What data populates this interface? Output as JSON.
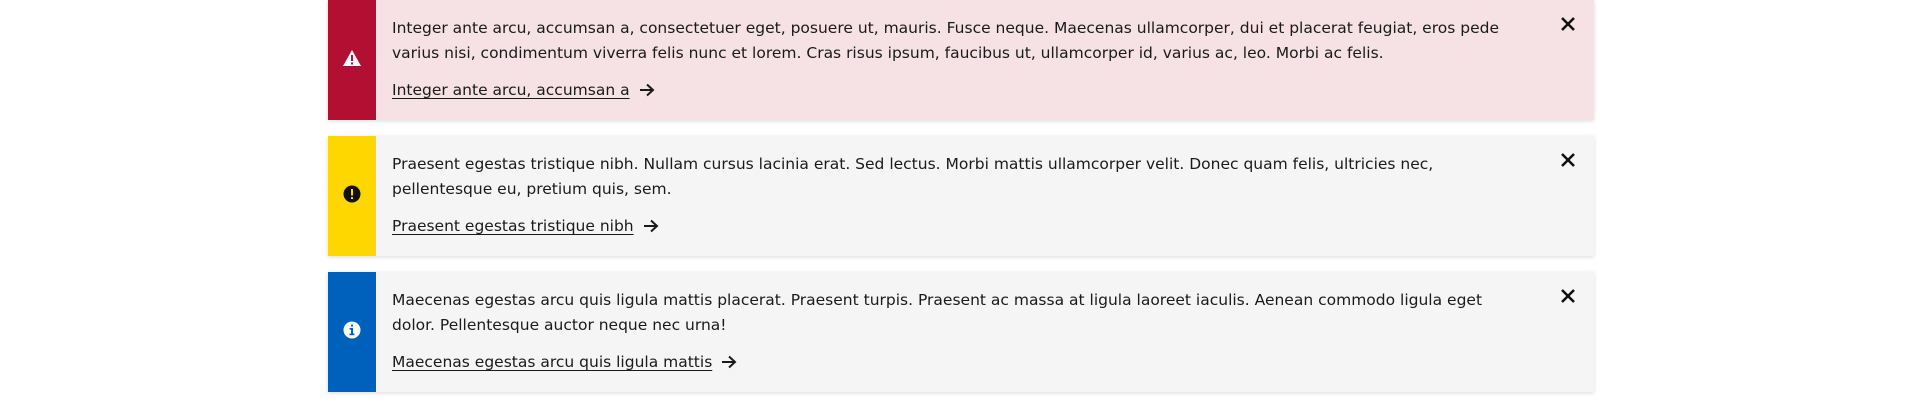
{
  "alerts": [
    {
      "type": "error",
      "icon": "warning-triangle-icon",
      "accent_color": "#b20f33",
      "background": "#f6e1e5",
      "text": "Integer ante arcu, accumsan a, consectetuer eget, posuere ut, mauris. Fusce neque. Maecenas ullamcorper, dui et placerat feugiat, eros pede varius nisi, condimentum viverra felis nunc et lorem. Cras risus ipsum, faucibus ut, ullamcorper id, varius ac, leo. Morbi ac felis.",
      "link_label": "Integer ante arcu, accumsan a",
      "close_icon": "close-icon"
    },
    {
      "type": "warning",
      "icon": "exclamation-circle-icon",
      "accent_color": "#ffd700",
      "background": "#f5f5f5",
      "text": "Praesent egestas tristique nibh. Nullam cursus lacinia erat. Sed lectus. Morbi mattis ullamcorper velit. Donec quam felis, ultricies nec, pellentesque eu, pretium quis, sem.",
      "link_label": "Praesent egestas tristique nibh",
      "close_icon": "close-icon"
    },
    {
      "type": "info",
      "icon": "info-circle-icon",
      "accent_color": "#0061bc",
      "background": "#f5f5f5",
      "text": "Maecenas egestas arcu quis ligula mattis placerat. Praesent turpis. Praesent ac massa at ligula laoreet iaculis. Aenean commodo ligula eget dolor. Pellentesque auctor neque nec urna!",
      "link_label": "Maecenas egestas arcu quis ligula mattis",
      "close_icon": "close-icon"
    }
  ]
}
